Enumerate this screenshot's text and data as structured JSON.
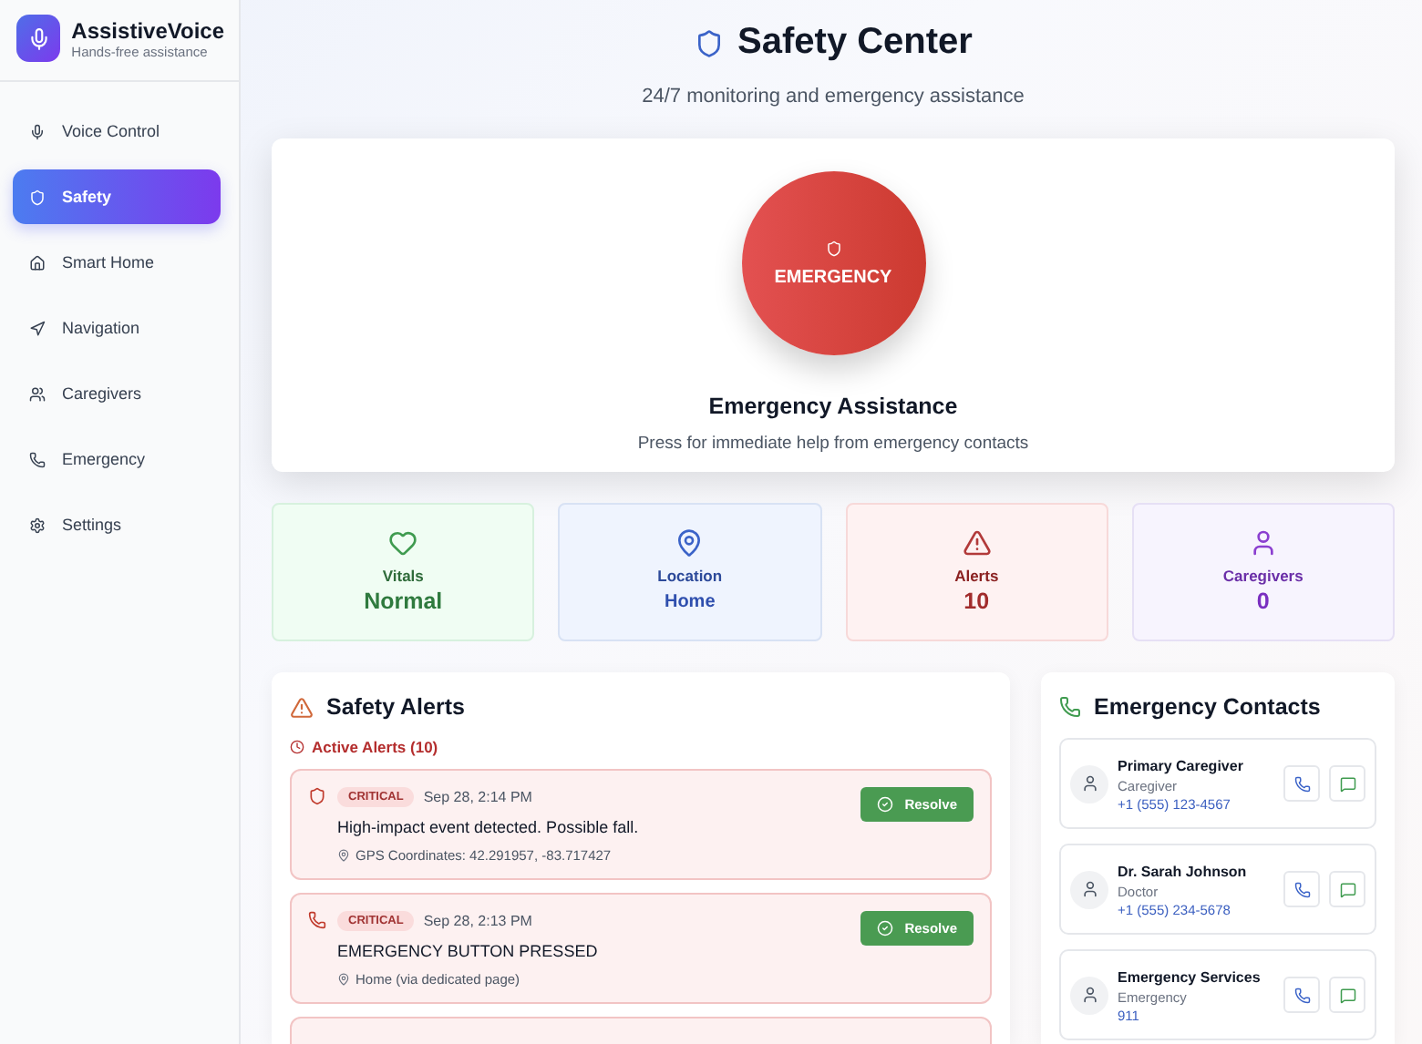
{
  "app": {
    "name": "AssistiveVoice",
    "tagline": "Hands-free assistance"
  },
  "sidebar": {
    "items": [
      {
        "label": "Voice Control",
        "selected": false
      },
      {
        "label": "Safety",
        "selected": true
      },
      {
        "label": "Smart Home",
        "selected": false
      },
      {
        "label": "Navigation",
        "selected": false
      },
      {
        "label": "Caregivers",
        "selected": false
      },
      {
        "label": "Emergency",
        "selected": false
      },
      {
        "label": "Settings",
        "selected": false
      }
    ]
  },
  "header": {
    "title": "Safety Center",
    "subtitle": "24/7 monitoring and emergency assistance"
  },
  "emergency": {
    "button": "EMERGENCY",
    "title": "Emergency Assistance",
    "description": "Press for immediate help from emergency contacts"
  },
  "stats": [
    {
      "kind": "vitals",
      "label": "Vitals",
      "value": "Normal"
    },
    {
      "kind": "location",
      "label": "Location",
      "value": "Home"
    },
    {
      "kind": "alerts",
      "label": "Alerts",
      "value": "10"
    },
    {
      "kind": "caregivers",
      "label": "Caregivers",
      "value": "0"
    }
  ],
  "alerts_panel": {
    "title": "Safety Alerts",
    "active_label": "Active Alerts (10)",
    "alerts": [
      {
        "kind": "shield",
        "severity": "CRITICAL",
        "time": "Sep 28, 2:14 PM",
        "message": "High-impact event detected. Possible fall.",
        "location": "GPS Coordinates: 42.291957, -83.717427",
        "action": "Resolve"
      },
      {
        "kind": "phone",
        "severity": "CRITICAL",
        "time": "Sep 28, 2:13 PM",
        "message": "EMERGENCY BUTTON PRESSED",
        "location": "Home (via dedicated page)",
        "action": "Resolve"
      }
    ]
  },
  "contacts_panel": {
    "title": "Emergency Contacts",
    "contacts": [
      {
        "name": "Primary Caregiver",
        "role": "Caregiver",
        "phone": "+1 (555) 123-4567"
      },
      {
        "name": "Dr. Sarah Johnson",
        "role": "Doctor",
        "phone": "+1 (555) 234-5678"
      },
      {
        "name": "Emergency Services",
        "role": "Emergency",
        "phone": "911"
      }
    ]
  }
}
